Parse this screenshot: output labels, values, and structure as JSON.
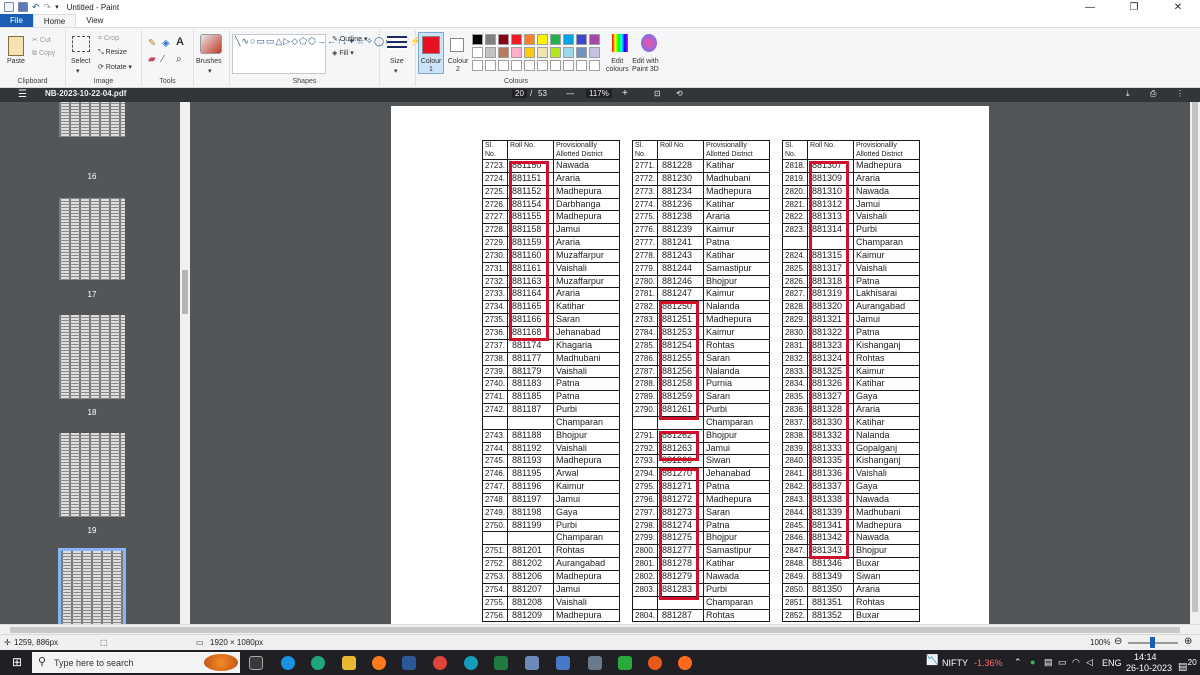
{
  "title_bar": {
    "title": "Untitled - Paint",
    "minimize": "—",
    "maximize": "❐",
    "close": "✕"
  },
  "menu": {
    "file": "File",
    "home": "Home",
    "view": "View"
  },
  "ribbon": {
    "clipboard": {
      "label": "Clipboard",
      "paste": "Paste",
      "cut": "Cut",
      "copy": "Copy"
    },
    "image": {
      "label": "Image",
      "select": "Select",
      "crop": "Crop",
      "resize": "Resize",
      "rotate": "Rotate"
    },
    "tools": {
      "label": "Tools",
      "text_tool": "A"
    },
    "brushes": "Brushes",
    "shapes": {
      "label": "Shapes",
      "outline": "Outline",
      "fill": "Fill"
    },
    "size": "Size",
    "colour1": [
      "Colour",
      "1"
    ],
    "colour2": [
      "Colour",
      "2"
    ],
    "colours_label": "Colours",
    "edit_colours": [
      "Edit",
      "colours"
    ],
    "paint3d": [
      "Edit with",
      "Paint 3D"
    ],
    "colour1_value": "#e81123",
    "palette_row1": [
      "#000000",
      "#7f7f7f",
      "#880015",
      "#ed1c24",
      "#ff7f27",
      "#fff200",
      "#22b14c",
      "#00a2e8",
      "#3f48cc",
      "#a349a4"
    ],
    "palette_row2": [
      "#ffffff",
      "#c3c3c3",
      "#b97a57",
      "#ffaec9",
      "#ffc90e",
      "#efe4b0",
      "#b5e61d",
      "#99d9ea",
      "#7092be",
      "#c8bfe7"
    ]
  },
  "pdf": {
    "filename": "NB-2023-10-22-04.pdf",
    "page_current": "20",
    "page_sep": "/",
    "page_total": "53",
    "minus": "—",
    "zoom": "117%",
    "plus": "+"
  },
  "thumbnails": [
    "16",
    "17",
    "18",
    "19"
  ],
  "columns": {
    "sl": "Sl.",
    "no": "No.",
    "roll": "Roll No.",
    "district1": "Provisionallly",
    "district2": "Allotted District"
  },
  "table1": [
    [
      "2723.",
      "881150",
      "Nawada"
    ],
    [
      "2724.",
      "881151",
      "Araria"
    ],
    [
      "2725.",
      "881152",
      "Madhepura"
    ],
    [
      "2726.",
      "881154",
      "Darbhanga"
    ],
    [
      "2727.",
      "881155",
      "Madhepura"
    ],
    [
      "2728.",
      "881158",
      "Jamui"
    ],
    [
      "2729.",
      "881159",
      "Araria"
    ],
    [
      "2730.",
      "881160",
      "Muzaffarpur"
    ],
    [
      "2731.",
      "881161",
      "Vaishali"
    ],
    [
      "2732.",
      "881163",
      "Muzaffarpur"
    ],
    [
      "2733.",
      "881164",
      "Araria"
    ],
    [
      "2734.",
      "881165",
      "Katihar"
    ],
    [
      "2735.",
      "881166",
      "Saran"
    ],
    [
      "2736.",
      "881168",
      "Jehanabad"
    ],
    [
      "2737.",
      "881174",
      "Khagaria"
    ],
    [
      "2738.",
      "881177",
      "Madhubani"
    ],
    [
      "2739.",
      "881179",
      "Vaishali"
    ],
    [
      "2740.",
      "881183",
      "Patna"
    ],
    [
      "2741.",
      "881185",
      "Patna"
    ],
    [
      "2742.",
      "881187",
      "Purbi"
    ],
    [
      "",
      "",
      "Champaran"
    ],
    [
      "2743.",
      "881188",
      "Bhojpur"
    ],
    [
      "2744.",
      "881192",
      "Vaishali"
    ],
    [
      "2745.",
      "881193",
      "Madhepura"
    ],
    [
      "2746.",
      "881195",
      "Arwal"
    ],
    [
      "2747.",
      "881196",
      "Kaimur"
    ],
    [
      "2748.",
      "881197",
      "Jamui"
    ],
    [
      "2749.",
      "881198",
      "Gaya"
    ],
    [
      "2750.",
      "881199",
      "Purbi"
    ],
    [
      "",
      "",
      "Champaran"
    ],
    [
      "2751.",
      "881201",
      "Rohtas"
    ],
    [
      "2752.",
      "881202",
      "Aurangabad"
    ],
    [
      "2753.",
      "881206",
      "Madhepura"
    ],
    [
      "2754.",
      "881207",
      "Jamui"
    ],
    [
      "2755.",
      "881208",
      "Vaishali"
    ],
    [
      "2756.",
      "881209",
      "Madhepura"
    ]
  ],
  "table2": [
    [
      "2771.",
      "881228",
      "Katihar"
    ],
    [
      "2772.",
      "881230",
      "Madhubani"
    ],
    [
      "2773.",
      "881234",
      "Madhepura"
    ],
    [
      "2774.",
      "881236",
      "Katihar"
    ],
    [
      "2775.",
      "881238",
      "Araria"
    ],
    [
      "2776.",
      "881239",
      "Kaimur"
    ],
    [
      "2777.",
      "881241",
      "Patna"
    ],
    [
      "2778.",
      "881243",
      "Katihar"
    ],
    [
      "2779.",
      "881244",
      "Samastipur"
    ],
    [
      "2780.",
      "881246",
      "Bhojpur"
    ],
    [
      "2781.",
      "881247",
      "Kaimur"
    ],
    [
      "2782.",
      "881250",
      "Nalanda"
    ],
    [
      "2783.",
      "881251",
      "Madhepura"
    ],
    [
      "2784.",
      "881253",
      "Kaimur"
    ],
    [
      "2785.",
      "881254",
      "Rohtas"
    ],
    [
      "2786.",
      "881255",
      "Saran"
    ],
    [
      "2787.",
      "881256",
      "Nalanda"
    ],
    [
      "2788.",
      "881258",
      "Purnia"
    ],
    [
      "2789.",
      "881259",
      "Saran"
    ],
    [
      "2790.",
      "881261",
      "Purbi"
    ],
    [
      "",
      "",
      "Champaran"
    ],
    [
      "2791.",
      "881262",
      "Bhojpur"
    ],
    [
      "2792.",
      "881263",
      "Jamui"
    ],
    [
      "2793.",
      "881266",
      "Siwan"
    ],
    [
      "2794.",
      "881270",
      "Jehanabad"
    ],
    [
      "2795.",
      "881271",
      "Patna"
    ],
    [
      "2796.",
      "881272",
      "Madhepura"
    ],
    [
      "2797.",
      "881273",
      "Saran"
    ],
    [
      "2798.",
      "881274",
      "Patna"
    ],
    [
      "2799.",
      "881275",
      "Bhojpur"
    ],
    [
      "2800.",
      "881277",
      "Samastipur"
    ],
    [
      "2801.",
      "881278",
      "Katihar"
    ],
    [
      "2802.",
      "881279",
      "Nawada"
    ],
    [
      "2803.",
      "881283",
      "Purbi"
    ],
    [
      "",
      "",
      "Champaran"
    ],
    [
      "2804.",
      "881287",
      "Rohtas"
    ]
  ],
  "table3": [
    [
      "2818.",
      "881307",
      "Madhepura"
    ],
    [
      "2819.",
      "881309",
      "Araria"
    ],
    [
      "2820.",
      "881310",
      "Nawada"
    ],
    [
      "2821.",
      "881312",
      "Jamui"
    ],
    [
      "2822.",
      "881313",
      "Vaishali"
    ],
    [
      "2823.",
      "881314",
      "Purbi"
    ],
    [
      "",
      "",
      "Champaran"
    ],
    [
      "2824.",
      "881315",
      "Kaimur"
    ],
    [
      "2825.",
      "881317",
      "Vaishali"
    ],
    [
      "2826.",
      "881318",
      "Patna"
    ],
    [
      "2827.",
      "881319",
      "Lakhisarai"
    ],
    [
      "2828.",
      "881320",
      "Aurangabad"
    ],
    [
      "2829.",
      "881321",
      "Jamui"
    ],
    [
      "2830.",
      "881322",
      "Patna"
    ],
    [
      "2831.",
      "881323",
      "Kishanganj"
    ],
    [
      "2832.",
      "881324",
      "Rohtas"
    ],
    [
      "2833.",
      "881325",
      "Kaimur"
    ],
    [
      "2834.",
      "881326",
      "Katihar"
    ],
    [
      "2835.",
      "881327",
      "Gaya"
    ],
    [
      "2836.",
      "881328",
      "Araria"
    ],
    [
      "2837.",
      "881330",
      "Katihar"
    ],
    [
      "2838.",
      "881332",
      "Nalanda"
    ],
    [
      "2839.",
      "881333",
      "Gopalganj"
    ],
    [
      "2840.",
      "881335",
      "Kishanganj"
    ],
    [
      "2841.",
      "881336",
      "Vaishali"
    ],
    [
      "2842.",
      "881337",
      "Gaya"
    ],
    [
      "2843.",
      "881338",
      "Nawada"
    ],
    [
      "2844.",
      "881339",
      "Madhubani"
    ],
    [
      "2845.",
      "881341",
      "Madhepura"
    ],
    [
      "2846.",
      "881342",
      "Nawada"
    ],
    [
      "2847.",
      "881343",
      "Bhojpur"
    ],
    [
      "2848.",
      "881346",
      "Buxar"
    ],
    [
      "2849.",
      "881349",
      "Siwan"
    ],
    [
      "2850.",
      "881350",
      "Araria"
    ],
    [
      "2851.",
      "881351",
      "Rohtas"
    ],
    [
      "2852.",
      "881352",
      "Buxar"
    ]
  ],
  "status": {
    "cursor": "1259, 886px",
    "size": "1920 × 1080px",
    "zoom": "100%"
  },
  "taskbar": {
    "search_placeholder": "Type here to search",
    "nifty": "NIFTY",
    "nifty_change": "-1.36%",
    "lang": "ENG",
    "time": "14:14",
    "date": "26-10-2023",
    "notif": "20"
  }
}
